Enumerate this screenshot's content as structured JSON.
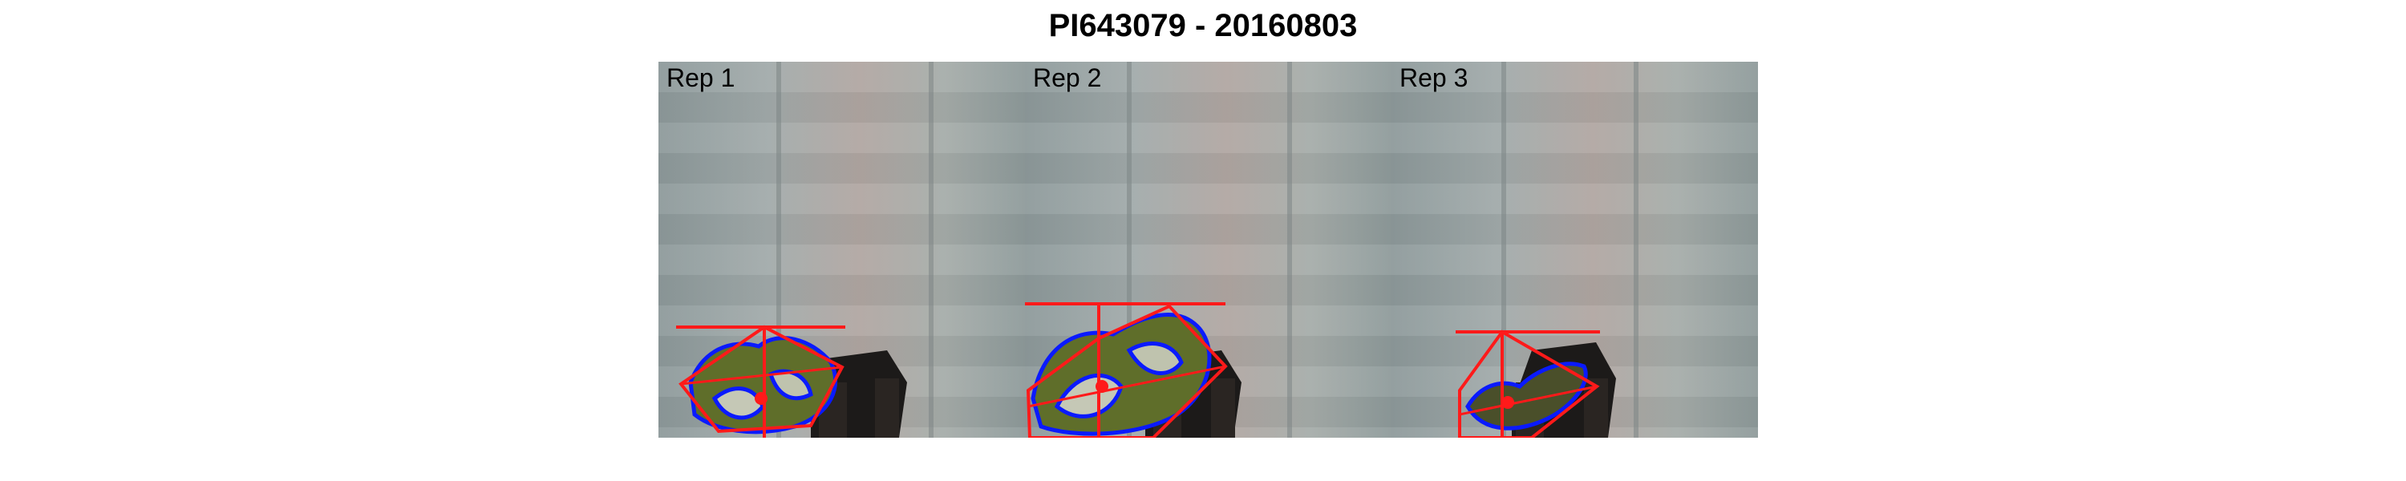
{
  "figure": {
    "title": "PI643079 - 20160803"
  },
  "panels": [
    {
      "label": "Rep 1"
    },
    {
      "label": "Rep 2"
    },
    {
      "label": "Rep 3"
    }
  ],
  "colors": {
    "hull_line": "#ff1a1a",
    "contour_line": "#0a1aff",
    "leaf_fill": "#5f6e2a",
    "pot": "#1c1a19"
  }
}
